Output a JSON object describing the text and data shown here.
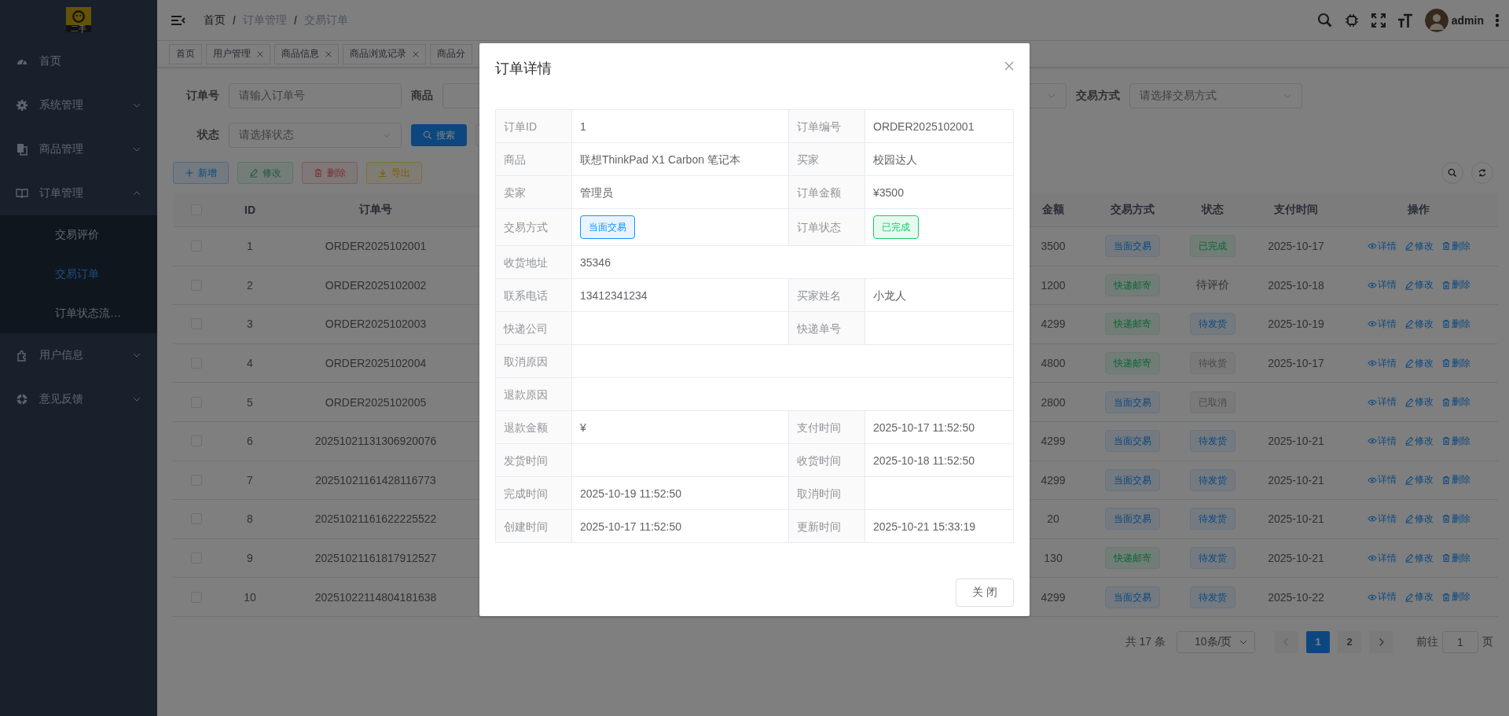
{
  "sidebar": {
    "logo_text": "二手",
    "items": [
      {
        "kind": "link",
        "label": "首页",
        "selected": false
      },
      {
        "kind": "group",
        "label": "系统管理",
        "expanded": false
      },
      {
        "kind": "group",
        "label": "商品管理",
        "expanded": false
      },
      {
        "kind": "group",
        "label": "订单管理",
        "expanded": true,
        "children": [
          {
            "label": "交易评价",
            "selected": false
          },
          {
            "label": "交易订单",
            "selected": true
          },
          {
            "label": "订单状态流…",
            "selected": false
          }
        ]
      },
      {
        "kind": "group",
        "label": "用户信息",
        "expanded": false
      },
      {
        "kind": "group",
        "label": "意见反馈",
        "expanded": false
      }
    ]
  },
  "header": {
    "breadcrumb": [
      "首页",
      "订单管理",
      "交易订单"
    ],
    "separator": "/",
    "user": "admin"
  },
  "tags": [
    {
      "label": "首页",
      "closable": false,
      "selected": false
    },
    {
      "label": "用户管理",
      "closable": true,
      "selected": false
    },
    {
      "label": "商品信息",
      "closable": true,
      "selected": false
    },
    {
      "label": "商品浏览记录",
      "closable": true,
      "selected": false
    },
    {
      "label": "商品分",
      "closable": false,
      "selected": false
    }
  ],
  "filters": {
    "row_1": [
      {
        "kind": "input",
        "label": "订单号",
        "placeholder": "请输入订单号"
      },
      {
        "kind": "input",
        "label": "商品"
      },
      {
        "kind": "select"
      },
      {
        "kind": "select",
        "label": "交易方式",
        "placeholder": "请选择交易方式"
      }
    ],
    "row_2": [
      {
        "kind": "select",
        "label": "状态",
        "placeholder": "请选择状态"
      }
    ],
    "search_button": "搜索"
  },
  "toolbar": [
    {
      "kind": "add",
      "label": "新增",
      "disabled": false
    },
    {
      "kind": "edit",
      "label": "修改",
      "disabled": true
    },
    {
      "kind": "delete",
      "label": "删除",
      "disabled": true
    },
    {
      "kind": "export",
      "label": "导出",
      "disabled": false
    }
  ],
  "table": {
    "select_all_checked": false,
    "columns": [
      "ID",
      "订单号",
      "金额",
      "交易方式",
      "状态",
      "支付时间",
      "操作"
    ],
    "rows": [
      {
        "checked": false,
        "id": "1",
        "order_no": "ORDER2025102001",
        "amount": "3500",
        "trade": {
          "text": "当面交易",
          "kind": "primary"
        },
        "status": {
          "text": "已完成",
          "kind": "success"
        },
        "pay_time": "2025-10-17",
        "actions": [
          {
            "kind": "view",
            "label": "详情"
          },
          {
            "kind": "edit",
            "label": "修改"
          },
          {
            "kind": "delete",
            "label": "删除"
          }
        ]
      },
      {
        "checked": false,
        "id": "2",
        "order_no": "ORDER2025102002",
        "amount": "1200",
        "trade": {
          "text": "快递邮寄",
          "kind": "success"
        },
        "status": {
          "text": "待评价",
          "kind": "plain"
        },
        "pay_time": "2025-10-18",
        "actions": [
          {
            "kind": "view",
            "label": "详情"
          },
          {
            "kind": "edit",
            "label": "修改"
          },
          {
            "kind": "delete",
            "label": "删除"
          }
        ]
      },
      {
        "checked": false,
        "id": "3",
        "order_no": "ORDER2025102003",
        "amount": "4299",
        "trade": {
          "text": "快递邮寄",
          "kind": "success"
        },
        "status": {
          "text": "待发货",
          "kind": "primary"
        },
        "pay_time": "2025-10-19",
        "actions": [
          {
            "kind": "view",
            "label": "详情"
          },
          {
            "kind": "edit",
            "label": "修改"
          },
          {
            "kind": "delete",
            "label": "删除"
          }
        ]
      },
      {
        "checked": false,
        "id": "4",
        "order_no": "ORDER2025102004",
        "amount": "4800",
        "trade": {
          "text": "快递邮寄",
          "kind": "success"
        },
        "status": {
          "text": "待收货",
          "kind": "info"
        },
        "pay_time": "2025-10-17",
        "actions": [
          {
            "kind": "view",
            "label": "详情"
          },
          {
            "kind": "edit",
            "label": "修改"
          },
          {
            "kind": "delete",
            "label": "删除"
          }
        ]
      },
      {
        "checked": false,
        "id": "5",
        "order_no": "ORDER2025102005",
        "amount": "2800",
        "trade": {
          "text": "当面交易",
          "kind": "primary"
        },
        "status": {
          "text": "已取消",
          "kind": "info"
        },
        "actions": [
          {
            "kind": "view",
            "label": "详情"
          },
          {
            "kind": "edit",
            "label": "修改"
          },
          {
            "kind": "delete",
            "label": "删除"
          }
        ]
      },
      {
        "checked": false,
        "id": "6",
        "order_no": "20251021131306920076",
        "amount": "4299",
        "trade": {
          "text": "当面交易",
          "kind": "primary"
        },
        "status": {
          "text": "待发货",
          "kind": "primary"
        },
        "pay_time": "2025-10-21",
        "actions": [
          {
            "kind": "view",
            "label": "详情"
          },
          {
            "kind": "edit",
            "label": "修改"
          },
          {
            "kind": "delete",
            "label": "删除"
          }
        ]
      },
      {
        "checked": false,
        "id": "7",
        "order_no": "20251021161428116773",
        "amount": "4299",
        "trade": {
          "text": "当面交易",
          "kind": "primary"
        },
        "status": {
          "text": "待发货",
          "kind": "primary"
        },
        "pay_time": "2025-10-21",
        "actions": [
          {
            "kind": "view",
            "label": "详情"
          },
          {
            "kind": "edit",
            "label": "修改"
          },
          {
            "kind": "delete",
            "label": "删除"
          }
        ]
      },
      {
        "checked": false,
        "id": "8",
        "order_no": "20251021161622225522",
        "amount": "20",
        "trade": {
          "text": "当面交易",
          "kind": "primary"
        },
        "status": {
          "text": "待发货",
          "kind": "primary"
        },
        "pay_time": "2025-10-21",
        "actions": [
          {
            "kind": "view",
            "label": "详情"
          },
          {
            "kind": "edit",
            "label": "修改"
          },
          {
            "kind": "delete",
            "label": "删除"
          }
        ]
      },
      {
        "checked": false,
        "id": "9",
        "order_no": "20251021161817912527",
        "amount": "130",
        "trade": {
          "text": "快递邮寄",
          "kind": "success"
        },
        "status": {
          "text": "待发货",
          "kind": "primary"
        },
        "pay_time": "2025-10-21",
        "actions": [
          {
            "kind": "view",
            "label": "详情"
          },
          {
            "kind": "edit",
            "label": "修改"
          },
          {
            "kind": "delete",
            "label": "删除"
          }
        ]
      },
      {
        "checked": false,
        "id": "10",
        "order_no": "20251022114804181638",
        "amount": "4299",
        "trade": {
          "text": "当面交易",
          "kind": "primary"
        },
        "status": {
          "text": "待发货",
          "kind": "primary"
        },
        "pay_time": "2025-10-22",
        "actions": [
          {
            "kind": "view",
            "label": "详情"
          },
          {
            "kind": "edit",
            "label": "修改"
          },
          {
            "kind": "delete",
            "label": "删除"
          }
        ]
      }
    ]
  },
  "pagination": {
    "total": "共 17 条",
    "page_size": "10条/页",
    "prev_disabled": true,
    "next_disabled": false,
    "pages": [
      {
        "label": "1",
        "selected": true
      },
      {
        "label": "2",
        "selected": false
      }
    ],
    "goto_label": "前往",
    "goto_value": "1",
    "goto_suffix": "页"
  },
  "modal": {
    "title": "订单详情",
    "button": "关 闭",
    "rows": [
      [
        {
          "label": "订单ID",
          "value": "1"
        },
        {
          "label": "订单编号",
          "value": "ORDER2025102001"
        }
      ],
      [
        {
          "label": "商品",
          "value": "联想ThinkPad X1 Carbon 笔记本"
        },
        {
          "label": "买家",
          "value": "校园达人"
        }
      ],
      [
        {
          "label": "卖家",
          "value": "管理员"
        },
        {
          "label": "订单金额",
          "value": "¥3500"
        }
      ],
      [
        {
          "label": "交易方式",
          "tag": {
            "text": "当面交易",
            "kind": "primary"
          }
        },
        {
          "label": "订单状态",
          "tag": {
            "text": "已完成",
            "kind": "success"
          }
        }
      ],
      [
        {
          "label": "收货地址",
          "value": "35346"
        }
      ],
      [
        {
          "label": "联系电话",
          "value": "13412341234"
        },
        {
          "label": "买家姓名",
          "value": "小龙人"
        }
      ],
      [
        {
          "label": "快递公司"
        },
        {
          "label": "快递单号"
        }
      ],
      [
        {
          "label": "取消原因"
        }
      ],
      [
        {
          "label": "退款原因"
        }
      ],
      [
        {
          "label": "退款金额",
          "value": "¥"
        },
        {
          "label": "支付时间",
          "value": "2025-10-17 11:52:50"
        }
      ],
      [
        {
          "label": "发货时间"
        },
        {
          "label": "收货时间",
          "value": "2025-10-18 11:52:50"
        }
      ],
      [
        {
          "label": "完成时间",
          "value": "2025-10-19 11:52:50"
        },
        {
          "label": "取消时间"
        }
      ],
      [
        {
          "label": "创建时间",
          "value": "2025-10-17 11:52:50"
        },
        {
          "label": "更新时间",
          "value": "2025-10-21 15:33:19"
        }
      ]
    ]
  }
}
